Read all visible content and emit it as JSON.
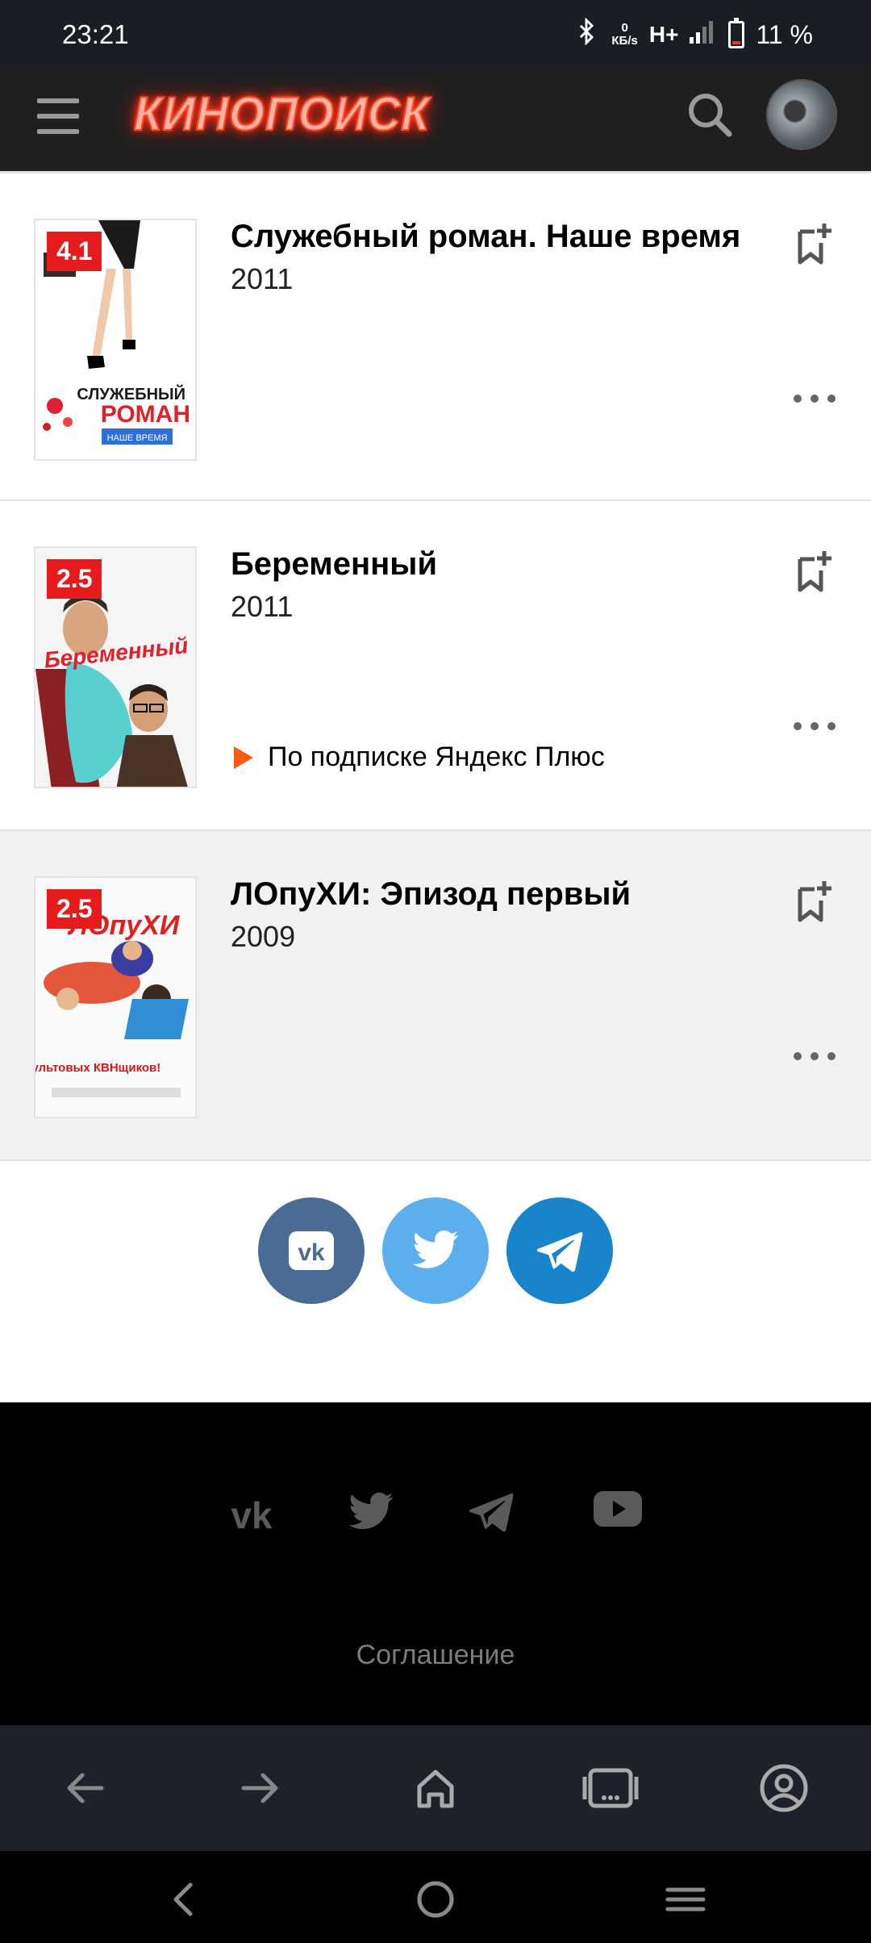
{
  "status_bar": {
    "time": "23:21",
    "speed_value": "0",
    "speed_unit": "КБ/s",
    "network": "H+",
    "battery": "11 %"
  },
  "header": {
    "logo_text": "КИНОПОИСК",
    "menu_icon": "menu-icon",
    "search_icon": "search-icon"
  },
  "movies": [
    {
      "rating": "4.1",
      "title": "Служебный роман. Наше время",
      "year": "2011",
      "poster_title_1": "СЛУЖЕБНЫЙ",
      "poster_title_2": "РОМАН",
      "poster_sub": "НАШЕ ВРЕМЯ"
    },
    {
      "rating": "2.5",
      "title": "Беременный",
      "year": "2011",
      "poster_title": "Беременный",
      "subscription": "По подписке Яндекс Плюс"
    },
    {
      "rating": "2.5",
      "title": "ЛОпуХИ: Эпизод первый",
      "year": "2009",
      "poster_title": "ЛОпуХИ",
      "poster_tagline": "От культовых КВНщиков!"
    }
  ],
  "footer": {
    "agreement": "Соглашение"
  },
  "colors": {
    "rating_bg": "#e61b1b",
    "accent_orange": "#ff5a14",
    "vk": "#4a6b94",
    "twitter": "#5daeec",
    "telegram": "#1784cb"
  }
}
